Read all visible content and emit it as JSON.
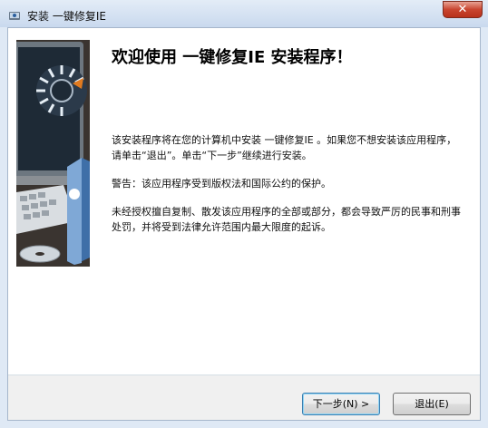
{
  "window": {
    "title": "安装 一键修复IE",
    "close_glyph": "✕"
  },
  "page": {
    "heading": "欢迎使用 一键修复IE 安装程序！",
    "paragraph_1": "该安装程序将在您的计算机中安装 一键修复IE 。如果您不想安装该应用程序，请单击“退出”。单击“下一步”继续进行安装。",
    "paragraph_2": "警告：该应用程序受到版权法和国际公约的保护。",
    "paragraph_3": "未经授权擅自复制、散发该应用程序的全部或部分，都会导致严厉的民事和刑事处罚，并将受到法律允许范围内最大限度的起诉。"
  },
  "buttons": {
    "next_label": "下一步(N) >",
    "exit_label": "退出(E)"
  },
  "colors": {
    "accent": "#3c7fb1",
    "close": "#c9452f"
  }
}
